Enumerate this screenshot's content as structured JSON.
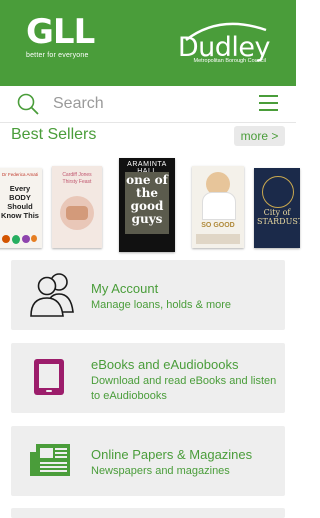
{
  "header": {
    "gll_logo": "GLL",
    "gll_tagline": "better for everyone",
    "council_logo": "Dudley",
    "council_subtitle": "Metropolitan Borough Council",
    "background": "#4a9d3a"
  },
  "search": {
    "placeholder": "Search",
    "search_icon": "search-icon",
    "menu_icon": "hamburger-menu-icon"
  },
  "best_sellers": {
    "title": "Best Sellers",
    "more_label": "more >",
    "books": [
      {
        "title_text": "Every BODY Should Know This",
        "author_text": "Dr Federica Amati"
      },
      {
        "title_text": "Cardiff Jones Thirsty Feast",
        "author_text": ""
      },
      {
        "title_text": "one of the good guys",
        "author_text": "ARAMINTA HALL"
      },
      {
        "title_text": "SO GOOD",
        "author_text": ""
      },
      {
        "title_text": "City of STARDUST",
        "author_text": ""
      }
    ]
  },
  "cards": [
    {
      "title": "My Account",
      "description": "Manage loans, holds & more",
      "icon": "users-icon"
    },
    {
      "title": "eBooks and eAudiobooks",
      "description": "Download and read eBooks and listen to eAudiobooks",
      "icon": "tablet-icon"
    },
    {
      "title": "Online Papers & Magazines",
      "description": "Newspapers and magazines",
      "icon": "newspaper-icon"
    }
  ],
  "colors": {
    "brand_green": "#4a9d3a",
    "ebook_purple": "#9c1d6b",
    "card_bg": "#eeeeee"
  }
}
